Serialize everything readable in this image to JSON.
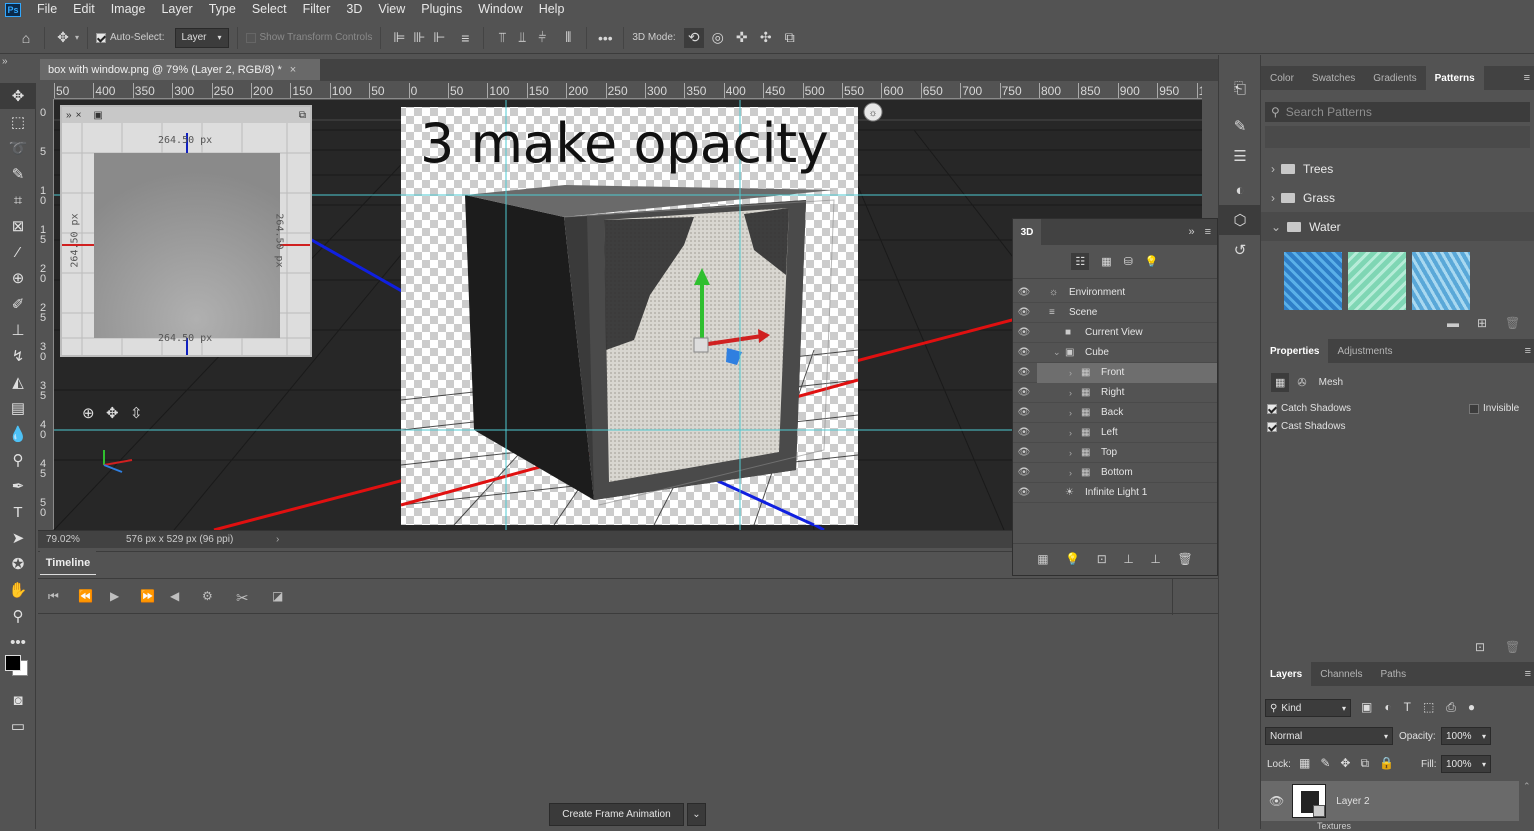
{
  "app": {
    "logo": "Ps"
  },
  "menu": [
    "File",
    "Edit",
    "Image",
    "Layer",
    "Type",
    "Select",
    "Filter",
    "3D",
    "View",
    "Plugins",
    "Window",
    "Help"
  ],
  "options": {
    "auto_select_label": "Auto-Select:",
    "auto_select_checked": true,
    "auto_select_value": "Layer",
    "show_transform_label": "Show Transform Controls",
    "mode_label": "3D Mode:",
    "more": "•••"
  },
  "document": {
    "tab_title": "box with window.png @ 79% (Layer 2, RGB/8) *",
    "canvas_text": "3 make opacity",
    "zoom": "79.02%",
    "doc_info": "576 px x 529 px (96 ppi)"
  },
  "ruler": {
    "h_labels": [
      "50",
      "400",
      "350",
      "300",
      "250",
      "200",
      "150",
      "100",
      "50",
      "0",
      "50",
      "100",
      "150",
      "200",
      "250",
      "300",
      "350",
      "400",
      "450",
      "500",
      "550",
      "600",
      "650",
      "700",
      "750",
      "800",
      "850",
      "900",
      "950",
      "10"
    ],
    "v_labels": [
      "0",
      "5",
      "1 0",
      "1 5",
      "2 0",
      "2 5",
      "3 0",
      "3 5",
      "4 0",
      "4 5",
      "5 0"
    ]
  },
  "uvmap": {
    "top": "264.50 px",
    "bottom": "264.50 px",
    "left": "264.50 px",
    "right": "264.50 px"
  },
  "timeline": {
    "tab": "Timeline",
    "create_button": "Create Frame Animation"
  },
  "panel3d": {
    "title": "3D",
    "rows": [
      {
        "label": "Environment",
        "indent": 0,
        "icon": "☼"
      },
      {
        "label": "Scene",
        "indent": 0,
        "icon": "≡"
      },
      {
        "label": "Current View",
        "indent": 1,
        "icon": "■"
      },
      {
        "label": "Cube",
        "indent": 1,
        "icon": "▣",
        "expanded": true
      },
      {
        "label": "Front",
        "indent": 2,
        "icon": "▦",
        "selected": true
      },
      {
        "label": "Right",
        "indent": 2,
        "icon": "▦"
      },
      {
        "label": "Back",
        "indent": 2,
        "icon": "▦"
      },
      {
        "label": "Left",
        "indent": 2,
        "icon": "▦"
      },
      {
        "label": "Top",
        "indent": 2,
        "icon": "▦"
      },
      {
        "label": "Bottom",
        "indent": 2,
        "icon": "▦"
      },
      {
        "label": "Infinite Light 1",
        "indent": 1,
        "icon": "☀"
      }
    ]
  },
  "patterns_panel": {
    "tabs": [
      "Color",
      "Swatches",
      "Gradients",
      "Patterns"
    ],
    "active_tab": "Patterns",
    "search_placeholder": "Search Patterns",
    "folders": [
      "Trees",
      "Grass",
      "Water"
    ],
    "swatch_colors": [
      "#2f7fc8",
      "#7fd6b4",
      "#5aa8d8"
    ]
  },
  "properties_panel": {
    "tabs": [
      "Properties",
      "Adjustments"
    ],
    "active_tab": "Properties",
    "mesh_label": "Mesh",
    "catch_shadows": "Catch Shadows",
    "cast_shadows": "Cast Shadows",
    "invisible": "Invisible"
  },
  "layers_panel": {
    "tabs": [
      "Layers",
      "Channels",
      "Paths"
    ],
    "active_tab": "Layers",
    "kind": "Kind",
    "blend_mode": "Normal",
    "opacity_label": "Opacity:",
    "opacity_value": "100%",
    "lock_label": "Lock:",
    "fill_label": "Fill:",
    "fill_value": "100%",
    "layer_name": "Layer 2",
    "textures_label": "Textures"
  },
  "colors": {
    "accent": "#31a8ff",
    "bg": "#535353",
    "dark": "#424242",
    "canvas": "#272727"
  }
}
